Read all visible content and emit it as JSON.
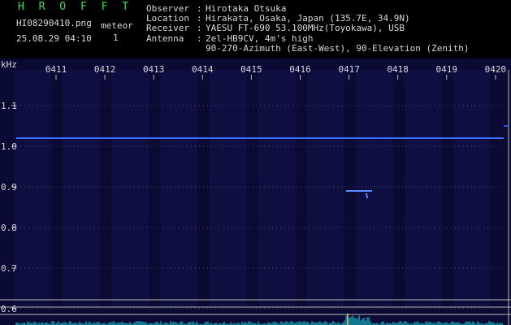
{
  "header": {
    "brand": "H R O F F T",
    "filename": "HI08290410.png",
    "datetime": "25.08.29 04:10",
    "meteor_label": "meteor",
    "meteor_count": "1"
  },
  "info": {
    "observer_key": "Observer",
    "observer_val": "Hirotaka Otsuka",
    "location_key": "Location",
    "location_val": "Hirakata, Osaka, Japan (135.7E, 34.9N)",
    "receiver_key": "Receiver",
    "receiver_val": "YAESU FT-690 53.100MHz(Toyokawa), USB",
    "antenna_key": "Antenna",
    "antenna_val": "2el-HB9CV, 4m's high",
    "antenna_val2": "90-270-Azimuth (East-West), 90-Elevation (Zenith)",
    "sep": ":"
  },
  "spectrogram": {
    "y_unit": "kHz",
    "y_ticks": [
      "1.1",
      "1.0",
      "0.9",
      "0.8",
      "0.7",
      "0.6"
    ],
    "x_ticks": [
      "0411",
      "0412",
      "0413",
      "0414",
      "0415",
      "0416",
      "0417",
      "0418",
      "0419",
      "0420"
    ],
    "carrier_khz": 1.02,
    "meteor_echo": {
      "time": "0417.2",
      "khz": 0.89
    },
    "background_color": "#0a0a35",
    "carrier_color": "#3a6cff",
    "noise_color": "#18c0d0",
    "grid_color": "#b8b8b8"
  }
}
